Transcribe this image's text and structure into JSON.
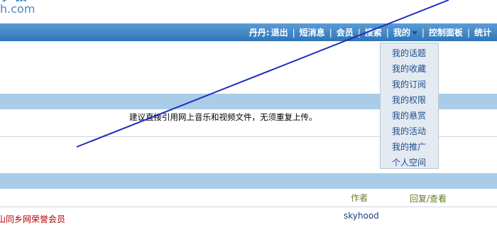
{
  "logo": {
    "domain": "h.com"
  },
  "nav": {
    "user": "丹丹:",
    "items": [
      "退出",
      "短消息",
      "会员",
      "搜索",
      "我的",
      "控制面板",
      "统计"
    ]
  },
  "notice": "建议直接引用网上音乐和视频文件，无须重复上传。",
  "columns": {
    "author": "作者",
    "reply_view": "回复/查看"
  },
  "row": {
    "title_partial": "山同乡网荣誉会员",
    "author": "skyhood"
  },
  "dropdown": {
    "items": [
      "我的话题",
      "我的收藏",
      "我的订阅",
      "我的权限",
      "我的悬赏",
      "我的活动",
      "我的推广",
      "个人空间"
    ]
  }
}
